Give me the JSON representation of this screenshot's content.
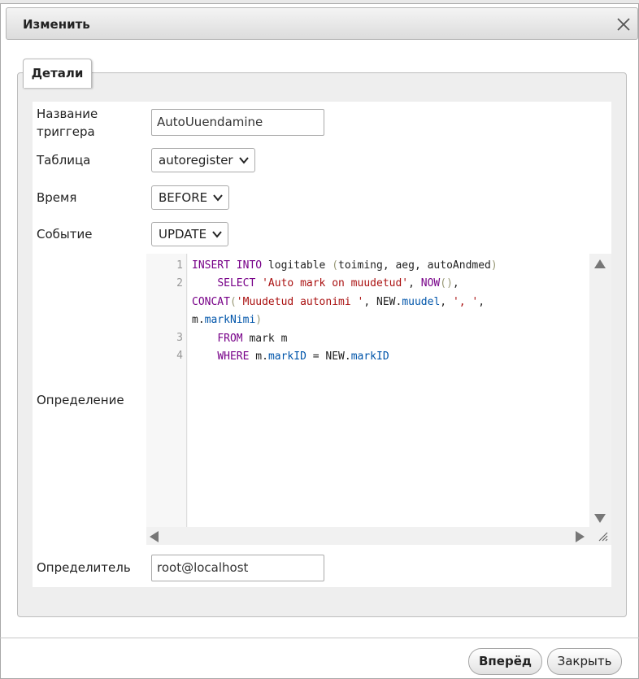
{
  "dialog": {
    "title": "Изменить",
    "tab_label": "Детали"
  },
  "form": {
    "trigger_name_label": "Название триггера",
    "trigger_name_value": "AutoUuendamine",
    "table_label": "Таблица",
    "table_value": "autoregister",
    "time_label": "Время",
    "time_value": "BEFORE",
    "event_label": "Событие",
    "event_value": "UPDATE",
    "definition_label": "Определение",
    "definer_label": "Определитель",
    "definer_value": "root@localhost"
  },
  "editor": {
    "line_numbers": [
      "1",
      "2",
      "3",
      "4"
    ],
    "code": "INSERT INTO logitable (toiming, aeg, autoAndmed)\n    SELECT 'Auto mark on muudetud', NOW(), CONCAT('Muudetud autonimi ', NEW.muudel, ', ', m.markNimi)\n    FROM mark m\n    WHERE m.markID = NEW.markID"
  },
  "buttons": {
    "go": "Вперёд",
    "close": "Закрыть"
  }
}
